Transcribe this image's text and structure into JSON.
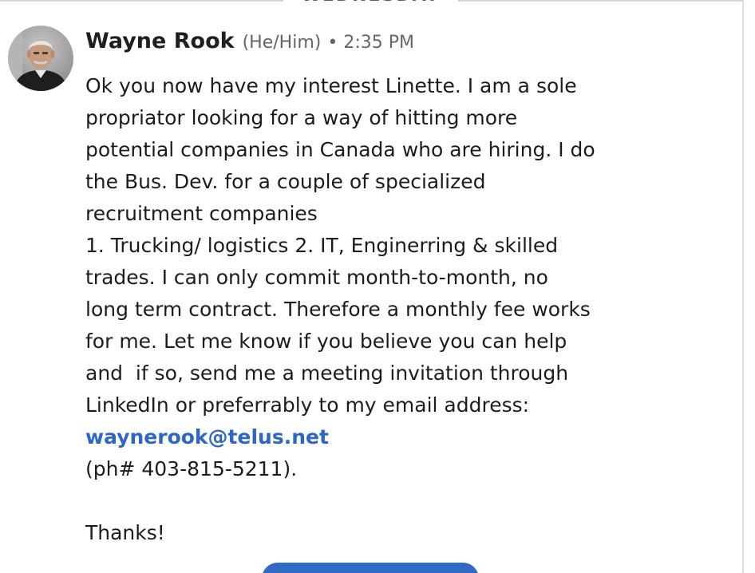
{
  "divider": {
    "day_label": "WEDNESDAY"
  },
  "message": {
    "sender_name": "Wayne Rook",
    "pronouns": "(He/Him)",
    "bullet": "•",
    "time": "2:35 PM",
    "lines": [
      "Ok you now have my interest Linette. I am a sole",
      "propriator looking for a way of hitting more",
      "potential companies in Canada who are hiring. I do",
      "the Bus. Dev. for a couple of specialized",
      "recruitment companies",
      "1. Trucking/ logistics 2. IT, Enginerring & skilled",
      "trades. I can only commit month-to-month, no",
      "long term contract. Therefore a monthly fee works",
      "for me. Let me know if you believe you can help",
      "and  if so, send me a meeting invitation through",
      "LinkedIn or preferrably to my email address:"
    ],
    "email": "waynerook@telus.net",
    "phone_line": "(ph# 403-815-5211).",
    "closing": "Thanks!"
  },
  "colors": {
    "link": "#2d66c4",
    "button": "#2f6bc6"
  },
  "icons": {
    "avatar": "profile-photo"
  }
}
